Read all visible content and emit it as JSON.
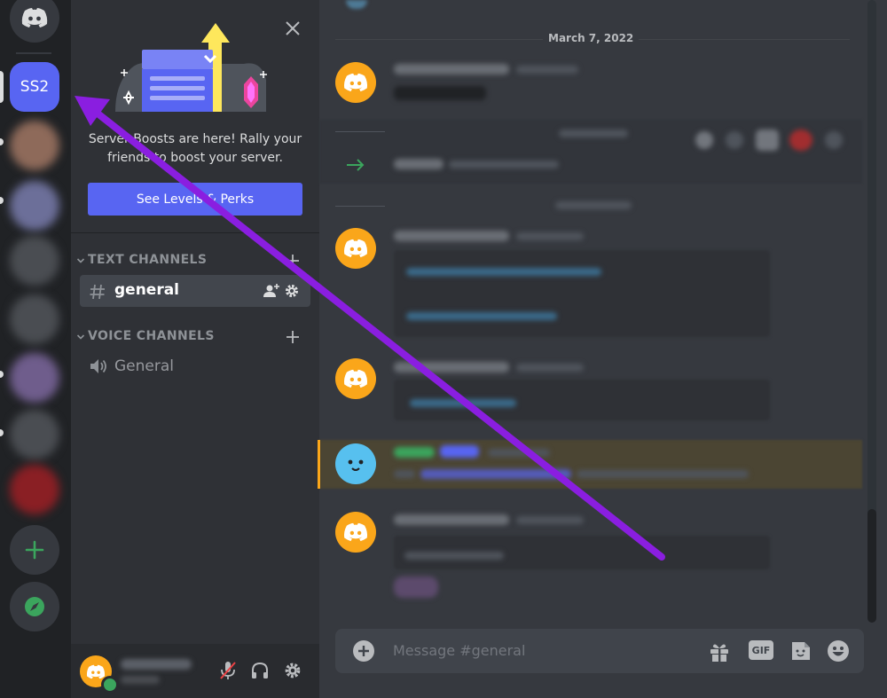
{
  "servers": {
    "active_server_label": "SS2",
    "add_server_icon": "plus-icon",
    "explore_icon": "compass-icon"
  },
  "boost_banner": {
    "text_line1": "Server Boosts are here! Rally your",
    "text_line2": "friends to boost your server.",
    "button_label": "See Levels & Perks"
  },
  "categories": {
    "text_label": "TEXT CHANNELS",
    "voice_label": "VOICE CHANNELS"
  },
  "channels": {
    "text": [
      {
        "name": "general"
      }
    ],
    "voice": [
      {
        "name": "General"
      }
    ]
  },
  "chat": {
    "date_divider": "March 7, 2022",
    "message_input_placeholder": "Message #general",
    "gif_label": "GIF"
  },
  "colors": {
    "accent": "#5865f2",
    "boost_pink": "#eb459e",
    "avatar_orange": "#faa61a",
    "annotation_arrow": "#8a1ee0",
    "online_green": "#3ba55d"
  }
}
